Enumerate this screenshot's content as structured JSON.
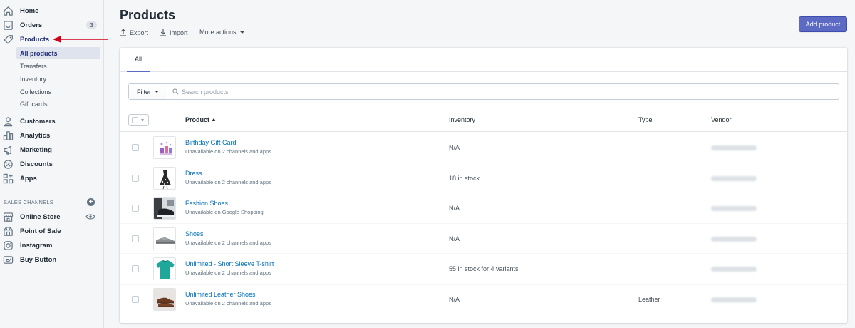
{
  "sidebar": {
    "main_items": [
      {
        "label": "Home",
        "icon": "home-icon"
      },
      {
        "label": "Orders",
        "icon": "orders-icon",
        "badge": "3"
      },
      {
        "label": "Products",
        "icon": "tag-icon"
      }
    ],
    "product_subitems": [
      {
        "label": "All products",
        "active": true
      },
      {
        "label": "Transfers"
      },
      {
        "label": "Inventory"
      },
      {
        "label": "Collections"
      },
      {
        "label": "Gift cards"
      }
    ],
    "more_items": [
      {
        "label": "Customers",
        "icon": "person-icon"
      },
      {
        "label": "Analytics",
        "icon": "bar-chart-icon"
      },
      {
        "label": "Marketing",
        "icon": "megaphone-icon"
      },
      {
        "label": "Discounts",
        "icon": "discount-icon"
      },
      {
        "label": "Apps",
        "icon": "apps-icon"
      }
    ],
    "sales_channels_title": "SALES CHANNELS",
    "channels": [
      {
        "label": "Online Store",
        "icon": "store-icon"
      },
      {
        "label": "Point of Sale",
        "icon": "pos-icon"
      },
      {
        "label": "Instagram",
        "icon": "instagram-icon"
      },
      {
        "label": "Buy Button",
        "icon": "buy-button-icon"
      }
    ]
  },
  "header": {
    "title": "Products",
    "export_label": "Export",
    "import_label": "Import",
    "more_actions_label": "More actions",
    "add_product_label": "Add product"
  },
  "tabs": [
    {
      "label": "All",
      "active": true
    }
  ],
  "filter": {
    "filter_label": "Filter",
    "search_placeholder": "Search products"
  },
  "table": {
    "columns": {
      "product": "Product",
      "inventory": "Inventory",
      "type": "Type",
      "vendor": "Vendor"
    },
    "rows": [
      {
        "name": "Birthday Gift Card",
        "sub": "Unavailable on 2 channels and apps",
        "inventory": "N/A",
        "type": "",
        "thumb": "gift-card"
      },
      {
        "name": "Dress",
        "sub": "Unavailable on 2 channels and apps",
        "inventory": "18 in stock",
        "type": "",
        "thumb": "dress"
      },
      {
        "name": "Fashion Shoes",
        "sub": "Unavailable on Google Shopping",
        "inventory": "N/A",
        "type": "",
        "thumb": "fashion-shoes"
      },
      {
        "name": "Shoes",
        "sub": "Unavailable on 2 channels and apps",
        "inventory": "N/A",
        "type": "",
        "thumb": "shoes"
      },
      {
        "name": "Unlimited - Short Sleeve T-shirt",
        "sub": "Unavailable on 2 channels and apps",
        "inventory": "55 in stock for 4 variants",
        "type": "",
        "thumb": "tshirt"
      },
      {
        "name": "Unlimited Leather Shoes",
        "sub": "Unavailable on 2 channels and apps",
        "inventory": "N/A",
        "type": "Leather",
        "thumb": "leather-shoes"
      }
    ]
  },
  "colors": {
    "accent": "#5c6ac4",
    "link": "#006fbb",
    "annotation_arrow": "#d0021b"
  }
}
